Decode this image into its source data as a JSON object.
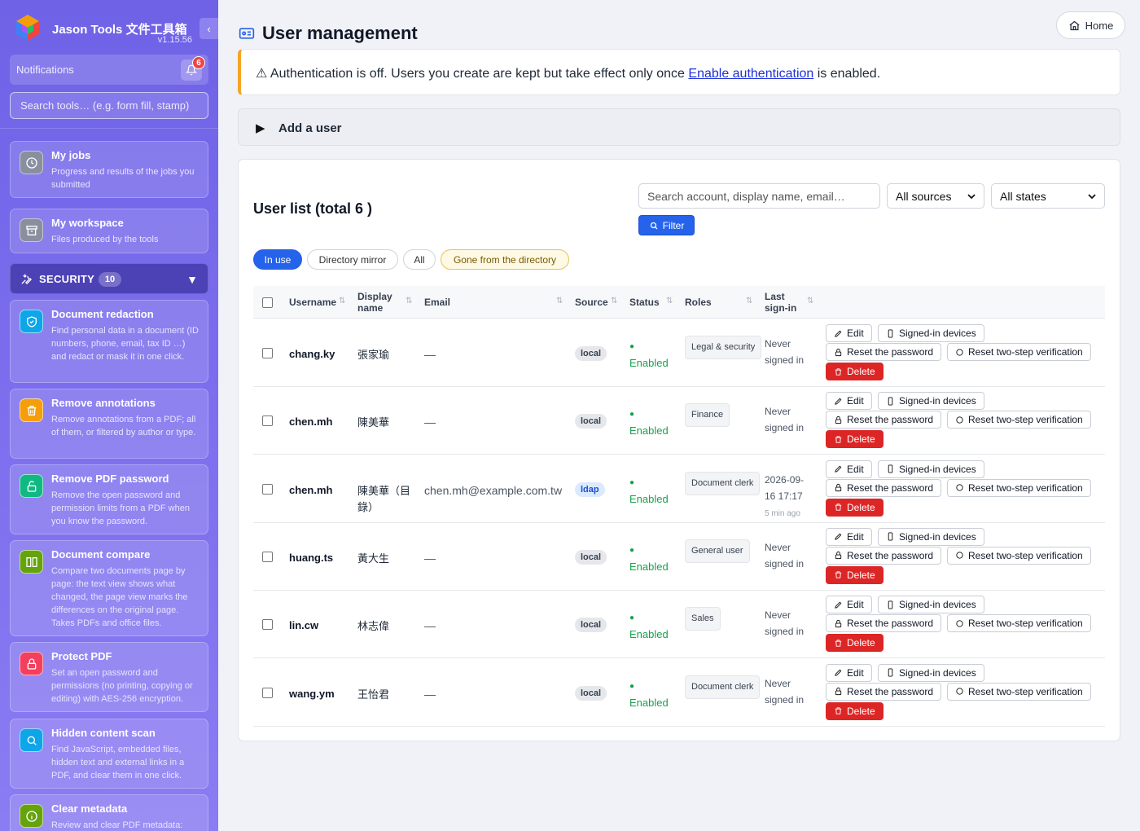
{
  "sidebar": {
    "brand_title": "Jason Tools 文件工具箱",
    "version": "v1.15.56",
    "collapse_label": "‹",
    "notifications_label": "Notifications",
    "notifications_count": "6",
    "search_placeholder": "Search tools… (e.g. form fill, stamp)",
    "top_cards": [
      {
        "title": "My jobs",
        "desc": "Progress and results of the jobs you submitted",
        "icon": "clock-icon"
      },
      {
        "title": "My workspace",
        "desc": "Files produced by the tools",
        "icon": "archive-icon"
      }
    ],
    "section": {
      "label": "SECURITY",
      "count": "10",
      "caret": "▼"
    },
    "tools": [
      {
        "title": "Document redaction",
        "desc": "Find personal data in a document (ID numbers, phone, email, tax ID …) and redact or mask it in one click.",
        "icon": "shield-check-icon",
        "color": "#0ea5e9"
      },
      {
        "title": "Remove annotations",
        "desc": "Remove annotations from a PDF; all of them, or filtered by author or type.",
        "icon": "trash-icon",
        "color": "#f59e0b"
      },
      {
        "title": "Remove PDF password",
        "desc": "Remove the open password and permission limits from a PDF when you know the password.",
        "icon": "unlock-icon",
        "color": "#10b981"
      },
      {
        "title": "Document compare",
        "desc": "Compare two documents page by page: the text view shows what changed, the page view marks the differences on the original page. Takes PDFs and office files.",
        "icon": "columns-icon",
        "color": "#65a30d"
      },
      {
        "title": "Protect PDF",
        "desc": "Set an open password and permissions (no printing, copying or editing) with AES-256 encryption.",
        "icon": "lock-icon",
        "color": "#f43f5e"
      },
      {
        "title": "Hidden content scan",
        "desc": "Find JavaScript, embedded files, hidden text and external links in a PDF, and clear them in one click.",
        "icon": "search-icon",
        "color": "#0ea5e9"
      },
      {
        "title": "Clear metadata",
        "desc": "Review and clear PDF metadata:",
        "icon": "info-icon",
        "color": "#65a30d"
      }
    ]
  },
  "header": {
    "title": "User management",
    "home_label": "Home"
  },
  "alert": {
    "prefix": "⚠ Authentication is off. Users you create are kept but take effect only once ",
    "link": "Enable authentication",
    "suffix": " is enabled."
  },
  "add_user": {
    "caret": "▶",
    "label": "Add a user"
  },
  "list": {
    "title": "User list (total 6 )",
    "search_placeholder": "Search account, display name, email…",
    "source_filter": "All sources",
    "state_filter": "All states",
    "filter_label": "Filter",
    "pills": [
      "In use",
      "Directory mirror",
      "All",
      "Gone from the directory"
    ],
    "columns": {
      "username": "Username",
      "display_name": "Display name",
      "email": "Email",
      "source": "Source",
      "status": "Status",
      "roles": "Roles",
      "last_signin": "Last sign-in"
    },
    "actions": {
      "edit": "Edit",
      "devices": "Signed-in devices",
      "reset_password": "Reset the password",
      "reset_2fa": "Reset two-step verification",
      "delete": "Delete"
    },
    "rows": [
      {
        "username": "chang.ky",
        "display": "張家瑜",
        "email": "—",
        "source": "local",
        "status": "Enabled",
        "role": "Legal & security",
        "signin": "Never signed in",
        "ago": ""
      },
      {
        "username": "chen.mh",
        "display": "陳美華",
        "email": "—",
        "source": "local",
        "status": "Enabled",
        "role": "Finance",
        "signin": "Never signed in",
        "ago": ""
      },
      {
        "username": "chen.mh",
        "display": "陳美華（目錄）",
        "email": "chen.mh@example.com.tw",
        "source": "ldap",
        "status": "Enabled",
        "role": "Document clerk",
        "signin": "2026-09-16 17:17",
        "ago": "5 min ago"
      },
      {
        "username": "huang.ts",
        "display": "黃大生",
        "email": "—",
        "source": "local",
        "status": "Enabled",
        "role": "General user",
        "signin": "Never signed in",
        "ago": ""
      },
      {
        "username": "lin.cw",
        "display": "林志偉",
        "email": "—",
        "source": "local",
        "status": "Enabled",
        "role": "Sales",
        "signin": "Never signed in",
        "ago": ""
      },
      {
        "username": "wang.ym",
        "display": "王怡君",
        "email": "—",
        "source": "local",
        "status": "Enabled",
        "role": "Document clerk",
        "signin": "Never signed in",
        "ago": ""
      }
    ]
  },
  "colors": {
    "accent": "#2563eb",
    "danger": "#dc2626",
    "success": "#16a34a",
    "warning": "#f5a524"
  }
}
